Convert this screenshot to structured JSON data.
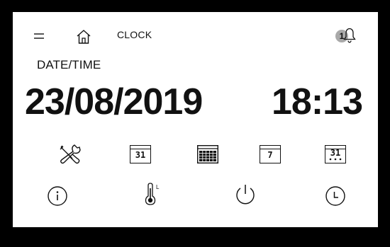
{
  "header": {
    "title": "CLOCK",
    "notification_count": "1"
  },
  "section": {
    "label": "DATE/TIME"
  },
  "datetime": {
    "date": "23/08/2019",
    "time": "18:13"
  },
  "toolbar": {
    "calendar_day_a": "31",
    "calendar_day_b": "7",
    "calendar_day_c": "31"
  },
  "icons": {
    "menu": "menu-icon",
    "home": "home-icon",
    "bell": "bell-icon",
    "tools": "tools-icon",
    "calendar_grid": "calendar-grid-icon",
    "info": "info-icon",
    "thermometer": "thermometer-icon",
    "power": "power-icon",
    "clock": "clock-icon"
  }
}
